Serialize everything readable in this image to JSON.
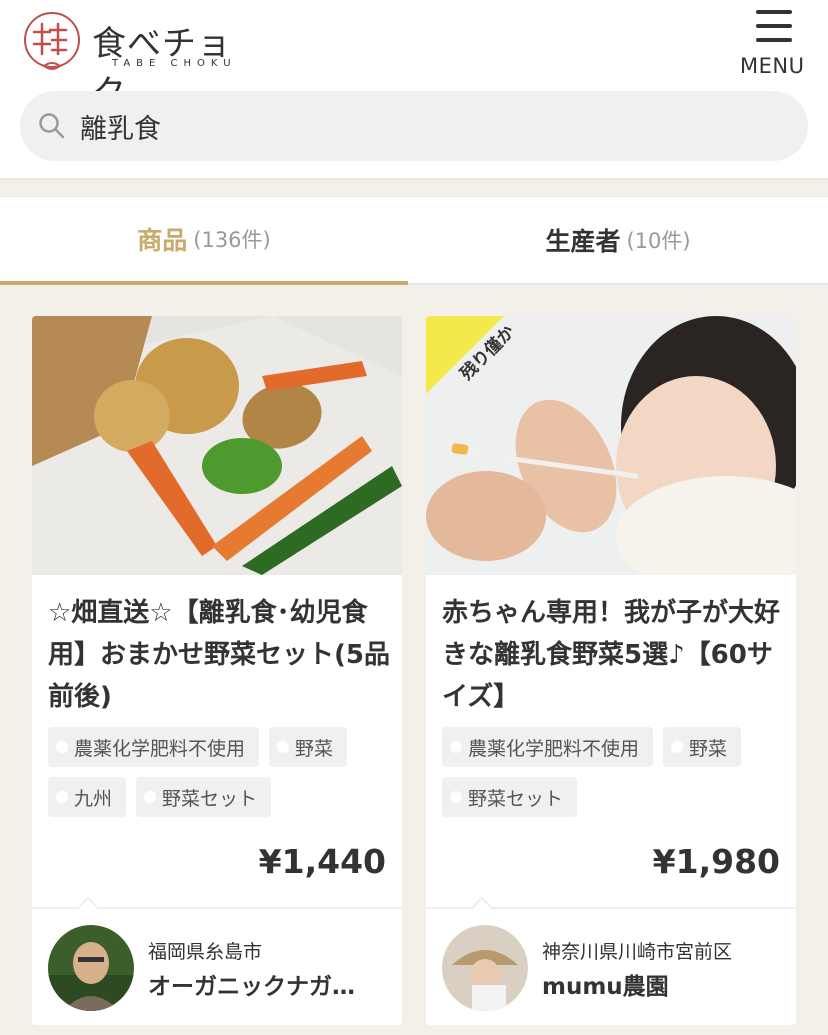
{
  "header": {
    "logo_text": "食べチョク",
    "logo_sub": "TABE CHOKU",
    "menu_label": "MENU"
  },
  "search": {
    "value": "離乳食",
    "icon": "search-icon"
  },
  "tabs": [
    {
      "label": "商品",
      "count": "(136件)",
      "active": true
    },
    {
      "label": "生産者",
      "count": "(10件)",
      "active": false
    }
  ],
  "colors": {
    "accent": "#c9ab6a",
    "ribbon": "#f5e84a"
  },
  "products": [
    {
      "title": "☆畑直送☆【離乳食･幼児食用】おまかせ野菜セット(5品前後)",
      "tags": [
        "農薬化学肥料不使用",
        "野菜",
        "九州",
        "野菜セット"
      ],
      "price": "¥1,440",
      "producer_location": "福岡県糸島市",
      "producer_name": "オーガニックナガ…"
    },
    {
      "title": "赤ちゃん専用！我が子が大好きな離乳食野菜5選♪【60サイズ】",
      "badge": "残り僅か",
      "tags": [
        "農薬化学肥料不使用",
        "野菜",
        "野菜セット"
      ],
      "price": "¥1,980",
      "producer_location": "神奈川県川崎市宮前区",
      "producer_name": "mumu農園"
    }
  ]
}
